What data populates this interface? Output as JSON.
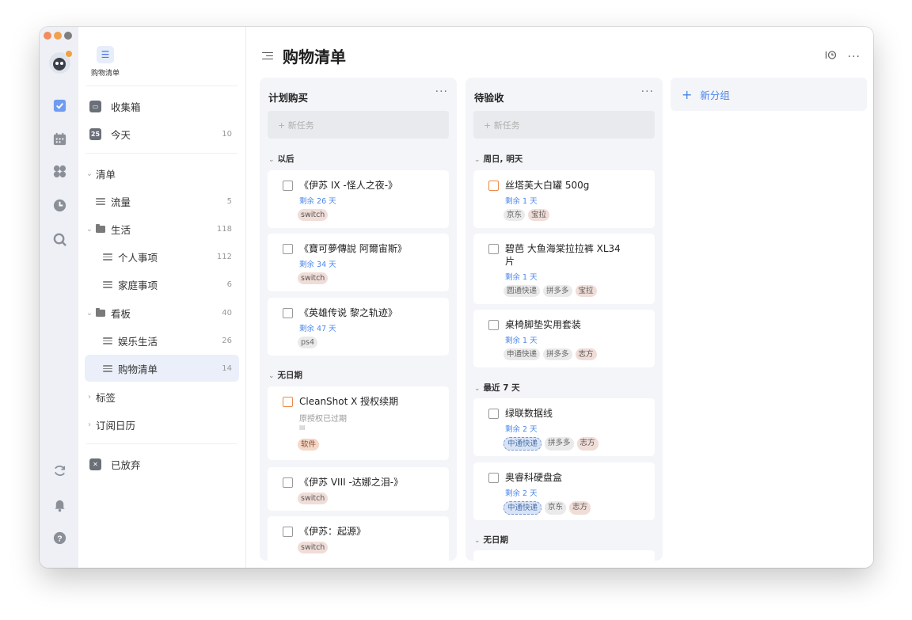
{
  "colors": {
    "accent": "#4a86e8",
    "rail_bg": "#eef0f6",
    "column_bg": "#f4f5f9",
    "traffic": [
      "#f28c5c",
      "#f0a24a",
      "#7f7f7f"
    ]
  },
  "sidebar_top": {
    "label": "购物清单",
    "icon": "list-icon"
  },
  "sidebar": {
    "inbox": {
      "label": "收集箱"
    },
    "today": {
      "label": "今天",
      "count": "10",
      "date": "25"
    },
    "lists_header": "清单",
    "items": [
      {
        "label": "流量",
        "count": "5"
      },
      {
        "label": "生活",
        "count": "118"
      },
      {
        "label": "个人事项",
        "count": "112"
      },
      {
        "label": "家庭事项",
        "count": "6"
      },
      {
        "label": "看板",
        "count": "40"
      },
      {
        "label": "娱乐生活",
        "count": "26"
      },
      {
        "label": "购物清单",
        "count": "14"
      }
    ],
    "tags_header": "标签",
    "calendar_header": "订阅日历",
    "abandoned": {
      "label": "已放弃"
    }
  },
  "main": {
    "title": "购物清单",
    "add_task_placeholder": "+ 新任务",
    "new_group": {
      "plus": "+",
      "label": "新分组"
    },
    "col1": {
      "title": "计划购买",
      "more": "···",
      "section1": "以后",
      "section2": "无日期",
      "cards": [
        {
          "title": "《伊苏 IX -怪人之夜-》",
          "due": "剩余 26 天",
          "tags": [
            "switch"
          ]
        },
        {
          "title": "《寶可夢傳說 阿爾宙斯》",
          "due": "剩余 34 天",
          "tags": [
            "switch"
          ]
        },
        {
          "title": "《英雄传说 黎之轨迹》",
          "due": "剩余 47 天",
          "tags": [
            "ps4"
          ]
        },
        {
          "title": "CleanShot X 授权续期",
          "note": "原授权已过期",
          "tags": [
            "软件"
          ]
        },
        {
          "title": "《伊苏 VIII -达娜之泪-》",
          "tags": [
            "switch"
          ]
        },
        {
          "title": "《伊苏：起源》",
          "tags": [
            "switch"
          ]
        }
      ]
    },
    "col2": {
      "title": "待验收",
      "more": "···",
      "section1": "周日, 明天",
      "section2": "最近 7 天",
      "section3": "无日期",
      "cards": [
        {
          "title": "丝塔芙大白罐 500g",
          "due": "剩余 1 天",
          "tags": [
            "京东",
            "宝拉"
          ]
        },
        {
          "title": "碧芭 大鱼海棠拉拉裤 XL34 片",
          "due": "剩余 1 天",
          "tags": [
            "圆通快递",
            "拼多多",
            "宝拉"
          ]
        },
        {
          "title": "桌椅脚垫实用套装",
          "due": "剩余 1 天",
          "tags": [
            "申通快递",
            "拼多多",
            "志方"
          ]
        },
        {
          "title": "绿联数据线",
          "due": "剩余 2 天",
          "tags": [
            "中通快递",
            "拼多多",
            "志方"
          ]
        },
        {
          "title": "奥睿科硬盘盒",
          "due": "剩余 2 天",
          "tags": [
            "中通快递",
            "京东",
            "志方"
          ]
        }
      ]
    }
  }
}
